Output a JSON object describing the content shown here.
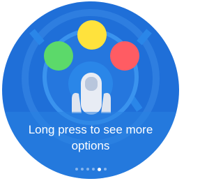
{
  "tutorial": {
    "caption_line1": "Long press to see more",
    "caption_line2": "options"
  },
  "pagination": {
    "total": 6,
    "current": 5
  },
  "colors": {
    "background": "#1f6fd8",
    "ring": "#2a86e8",
    "yellow_option": "#ffe23c",
    "green_option": "#5cd96a",
    "red_option": "#ff5c63",
    "finger": "#e8ecf4"
  },
  "icons": {
    "option_left": "green-circle",
    "option_top": "yellow-circle",
    "option_right": "red-circle",
    "gesture": "finger-press-icon"
  }
}
